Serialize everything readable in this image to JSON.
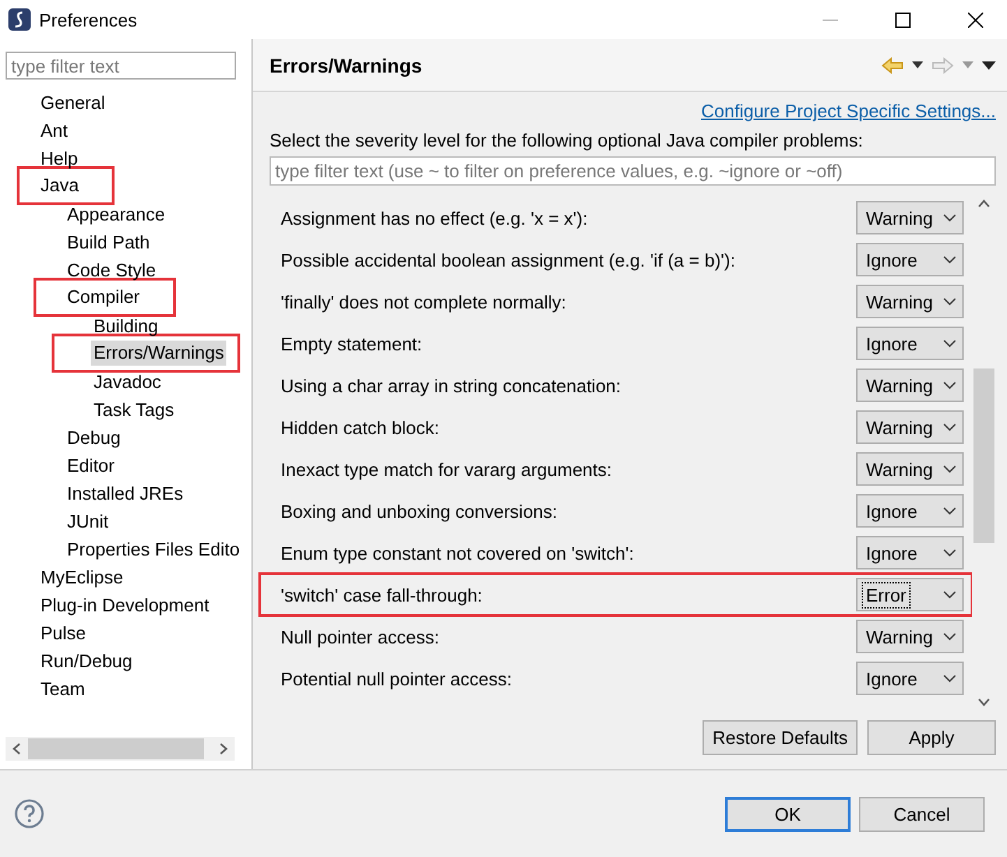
{
  "window": {
    "title": "Preferences"
  },
  "sidebar": {
    "filter": {
      "placeholder": "type filter text"
    },
    "tree": [
      {
        "label": "General",
        "selected": false,
        "highlighted": false
      },
      {
        "label": "Ant",
        "selected": false,
        "highlighted": false
      },
      {
        "label": "Help",
        "selected": false,
        "highlighted": false
      },
      {
        "label": "Java",
        "selected": false,
        "highlighted": true,
        "children": [
          {
            "label": "Appearance",
            "selected": false,
            "highlighted": false
          },
          {
            "label": "Build Path",
            "selected": false,
            "highlighted": false
          },
          {
            "label": "Code Style",
            "selected": false,
            "highlighted": false
          },
          {
            "label": "Compiler",
            "selected": false,
            "highlighted": true,
            "children": [
              {
                "label": "Building",
                "selected": false,
                "highlighted": false
              },
              {
                "label": "Errors/Warnings",
                "selected": true,
                "highlighted": true
              },
              {
                "label": "Javadoc",
                "selected": false,
                "highlighted": false
              },
              {
                "label": "Task Tags",
                "selected": false,
                "highlighted": false
              }
            ]
          },
          {
            "label": "Debug",
            "selected": false,
            "highlighted": false
          },
          {
            "label": "Editor",
            "selected": false,
            "highlighted": false
          },
          {
            "label": "Installed JREs",
            "selected": false,
            "highlighted": false
          },
          {
            "label": "JUnit",
            "selected": false,
            "highlighted": false
          },
          {
            "label": "Properties Files Edito",
            "selected": false,
            "highlighted": false
          }
        ]
      },
      {
        "label": "MyEclipse",
        "selected": false,
        "highlighted": false
      },
      {
        "label": "Plug-in Development",
        "selected": false,
        "highlighted": false
      },
      {
        "label": "Pulse",
        "selected": false,
        "highlighted": false
      },
      {
        "label": "Run/Debug",
        "selected": false,
        "highlighted": false
      },
      {
        "label": "Team",
        "selected": false,
        "highlighted": false
      }
    ]
  },
  "page": {
    "title": "Errors/Warnings",
    "link": "Configure Project Specific Settings...",
    "description": "Select the severity level for the following optional Java compiler problems:",
    "filter": {
      "placeholder": "type filter text (use ~ to filter on preference values, e.g. ~ignore or ~off)"
    },
    "problems": [
      {
        "label": "Assignment has no effect (e.g. 'x = x'):",
        "value": "Warning",
        "highlighted": false,
        "focused": false
      },
      {
        "label": "Possible accidental boolean assignment (e.g. 'if (a = b)'):",
        "value": "Ignore",
        "highlighted": false,
        "focused": false
      },
      {
        "label": "'finally' does not complete normally:",
        "value": "Warning",
        "highlighted": false,
        "focused": false
      },
      {
        "label": "Empty statement:",
        "value": "Ignore",
        "highlighted": false,
        "focused": false
      },
      {
        "label": "Using a char array in string concatenation:",
        "value": "Warning",
        "highlighted": false,
        "focused": false
      },
      {
        "label": "Hidden catch block:",
        "value": "Warning",
        "highlighted": false,
        "focused": false
      },
      {
        "label": "Inexact type match for vararg arguments:",
        "value": "Warning",
        "highlighted": false,
        "focused": false
      },
      {
        "label": "Boxing and unboxing conversions:",
        "value": "Ignore",
        "highlighted": false,
        "focused": false
      },
      {
        "label": "Enum type constant not covered on 'switch':",
        "value": "Ignore",
        "highlighted": false,
        "focused": false
      },
      {
        "label": "'switch' case fall-through:",
        "value": "Error",
        "highlighted": true,
        "focused": true
      },
      {
        "label": "Null pointer access:",
        "value": "Warning",
        "highlighted": false,
        "focused": false
      },
      {
        "label": "Potential null pointer access:",
        "value": "Ignore",
        "highlighted": false,
        "focused": false
      }
    ],
    "buttons": [
      "Restore Defaults",
      "Apply"
    ]
  },
  "footer": {
    "buttons": [
      "OK",
      "Cancel"
    ]
  }
}
